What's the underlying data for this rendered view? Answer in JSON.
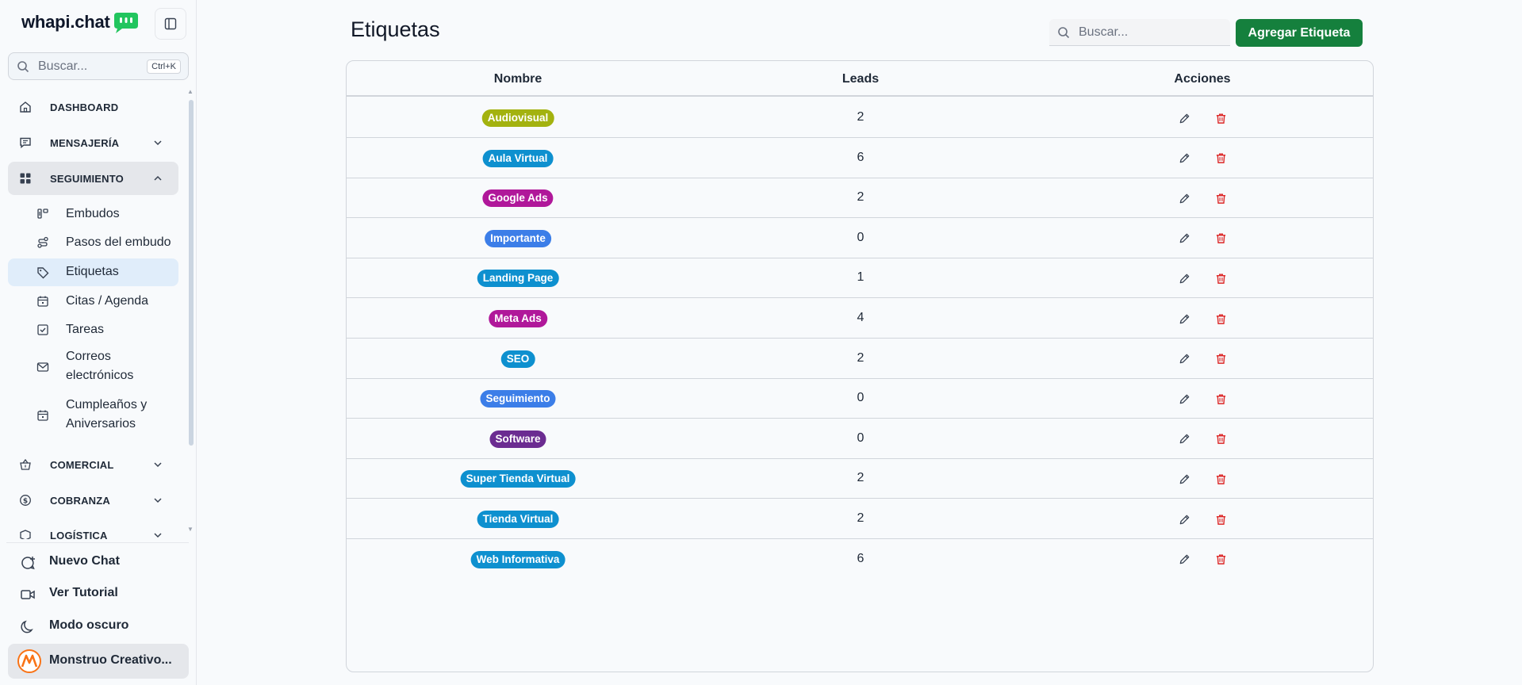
{
  "sidebar": {
    "brand": "whapi.chat",
    "search_placeholder": "Buscar...",
    "search_shortcut": "Ctrl+K",
    "sections": [
      {
        "label": "DASHBOARD",
        "icon": "home-icon"
      },
      {
        "label": "MENSAJERÍA",
        "icon": "message-icon"
      },
      {
        "label": "SEGUIMIENTO",
        "icon": "grid-icon",
        "open": true
      },
      {
        "label": "COMERCIAL",
        "icon": "basket-icon"
      },
      {
        "label": "COBRANZA",
        "icon": "dollar-icon"
      },
      {
        "label": "LOGÍSTICA",
        "icon": "box-icon"
      }
    ],
    "sub_items": [
      {
        "label": "Embudos",
        "icon": "kanban-icon"
      },
      {
        "label": "Pasos del embudo",
        "icon": "route-icon"
      },
      {
        "label": "Etiquetas",
        "icon": "tag-icon",
        "active": true
      },
      {
        "label": "Citas / Agenda",
        "icon": "calendar-icon"
      },
      {
        "label": "Tareas",
        "icon": "checkbox-icon"
      },
      {
        "label": "Correos electrónicos",
        "icon": "mail-icon"
      },
      {
        "label": "Cumpleaños y Aniversarios",
        "icon": "calendar-icon"
      }
    ],
    "bottom": {
      "new_chat": "Nuevo Chat",
      "tutorial": "Ver Tutorial",
      "dark_mode": "Modo oscuro",
      "user": "Monstruo Creativo..."
    }
  },
  "main": {
    "title": "Etiquetas",
    "search_placeholder": "Buscar...",
    "add_button": "Agregar Etiqueta",
    "columns": [
      "Nombre",
      "Leads",
      "Acciones"
    ],
    "rows": [
      {
        "name": "Audiovisual",
        "color": "#a3b20f",
        "leads": "2"
      },
      {
        "name": "Aula Virtual",
        "color": "#0e90cf",
        "leads": "6"
      },
      {
        "name": "Google Ads",
        "color": "#b0189a",
        "leads": "2"
      },
      {
        "name": "Importante",
        "color": "#3c7ee8",
        "leads": "0"
      },
      {
        "name": "Landing Page",
        "color": "#0e90cf",
        "leads": "1"
      },
      {
        "name": "Meta Ads",
        "color": "#b0189a",
        "leads": "4"
      },
      {
        "name": "SEO",
        "color": "#0e90cf",
        "leads": "2"
      },
      {
        "name": "Seguimiento",
        "color": "#3c7ee8",
        "leads": "0"
      },
      {
        "name": "Software",
        "color": "#6b2c91",
        "leads": "0"
      },
      {
        "name": "Super Tienda Virtual",
        "color": "#0e90cf",
        "leads": "2"
      },
      {
        "name": "Tienda Virtual",
        "color": "#0e90cf",
        "leads": "2"
      },
      {
        "name": "Web Informativa",
        "color": "#0e90cf",
        "leads": "6"
      }
    ]
  },
  "colors": {
    "accent_green": "#15803d",
    "delete_red": "#dc2626",
    "active_bg": "#e0edfa"
  }
}
